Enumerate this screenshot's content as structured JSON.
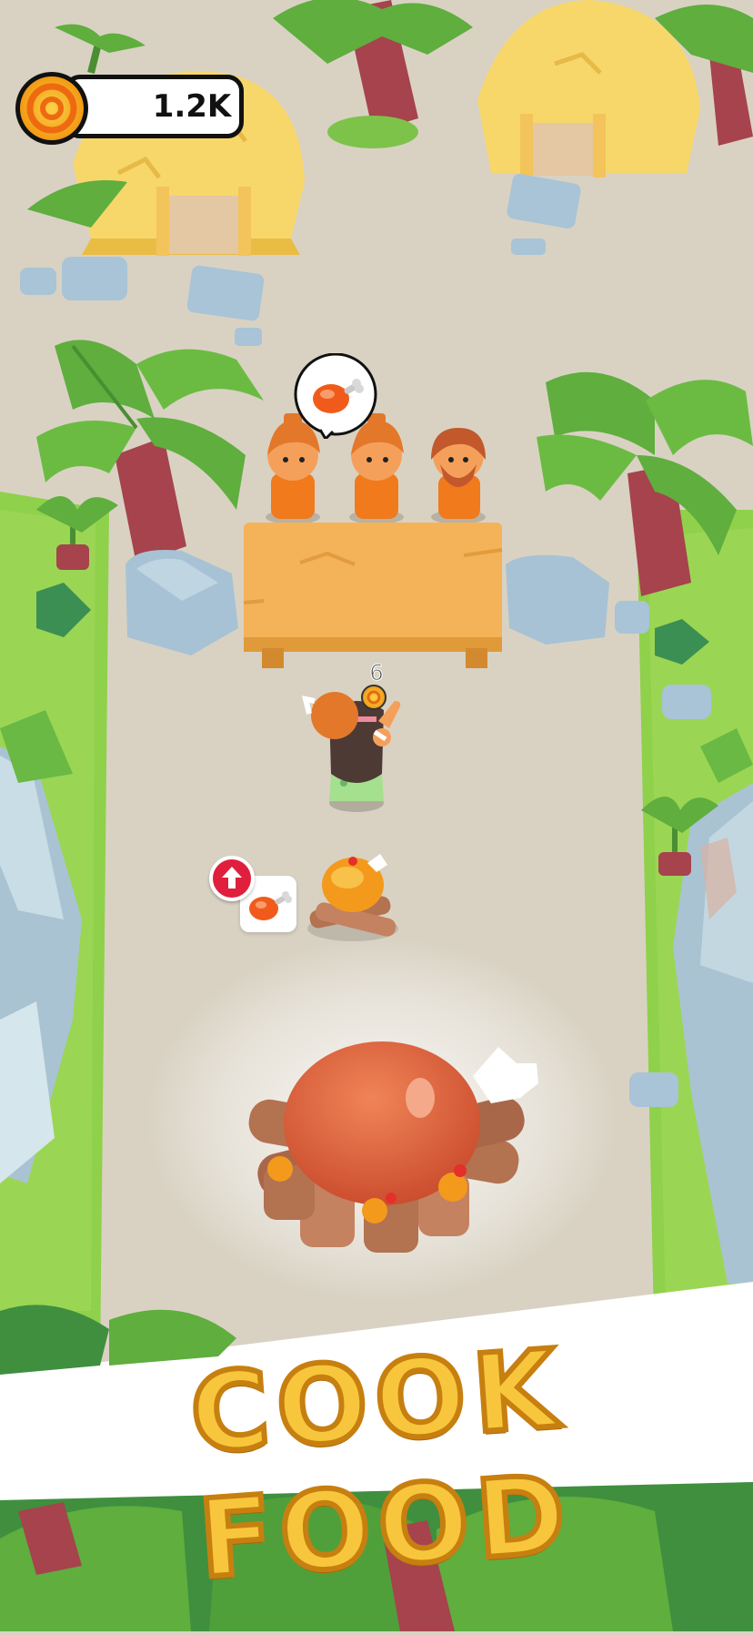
{
  "hud": {
    "coin_balance": "1.2K",
    "coin_icon": "gold-coin-icon"
  },
  "stand": {
    "price_label": "6",
    "order_icon": "meat-leg-icon"
  },
  "cooking_station": {
    "upgrade_icon": "red-up-arrow-icon",
    "product_icon": "meat-leg-icon"
  },
  "banner": {
    "text": "COOK FOOD"
  },
  "colors": {
    "path": "#d9d2c3",
    "grass": "#8fd14a",
    "wood": "#f4b358",
    "coin": "#f8b21b",
    "banner_text": "#f7c63c",
    "badge_red": "#e01f3d"
  }
}
